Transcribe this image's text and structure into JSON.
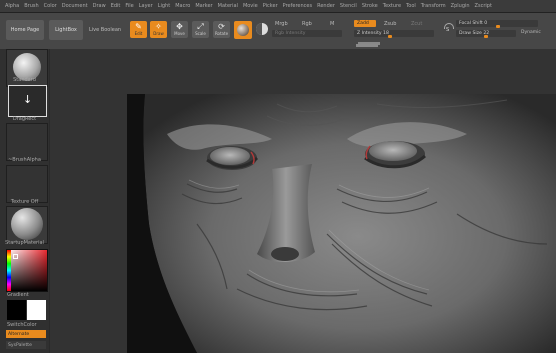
{
  "menu": [
    "Alpha",
    "Brush",
    "Color",
    "Document",
    "Draw",
    "Edit",
    "File",
    "Layer",
    "Light",
    "Macro",
    "Marker",
    "Material",
    "Movie",
    "Picker",
    "Preferences",
    "Render",
    "Stencil",
    "Stroke",
    "Texture",
    "Tool",
    "Transform",
    "Zplugin",
    "Zscript"
  ],
  "toolbar": {
    "home_page": "Home Page",
    "lightbox": "LightBox",
    "live_boolean": "Live Boolean",
    "edit": "Edit",
    "draw": "Draw",
    "move": "Move",
    "scale": "Scale",
    "rotate": "Rotate",
    "mrgb": "Mrgb",
    "rgb": "Rgb",
    "m": "M",
    "rgb_intensity": "Rgb Intensity",
    "zadd": "Zadd",
    "zsub": "Zsub",
    "zcut": "Zcut",
    "z_intensity": "Z Intensity 18",
    "focal_shift": "Focal Shift 0",
    "draw_size": "Draw Size 22",
    "dynamic": "Dynamic",
    "s_label": "S"
  },
  "leftpanel": {
    "standard": "Standard",
    "dragrect": "DragRect",
    "brush_alpha": "~BrushAlpha",
    "texture_off": "Texture Off",
    "startup_material": "StartupMaterial",
    "gradient": "Gradient",
    "switch_color": "SwitchColor",
    "alternate": "Alternate",
    "sys_palette": "SysPalette"
  },
  "colors": {
    "accent": "#e98b1e"
  },
  "icons": [
    "edit-icon",
    "draw-icon",
    "move-icon",
    "scale-icon",
    "rotate-icon",
    "material-sphere-icon",
    "brush-sphere-icon",
    "dragrect-arrow-icon"
  ]
}
